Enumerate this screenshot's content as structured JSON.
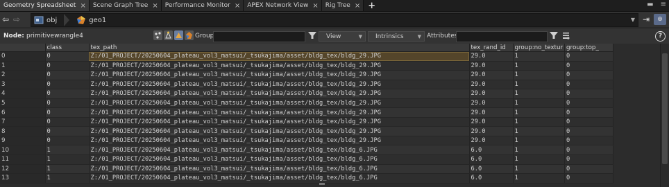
{
  "tabs": [
    {
      "label": "Geometry Spreadsheet",
      "active": true
    },
    {
      "label": "Scene Graph Tree",
      "active": false
    },
    {
      "label": "Performance Monitor",
      "active": false
    },
    {
      "label": "APEX Network View",
      "active": false
    },
    {
      "label": "Rig Tree",
      "active": false
    }
  ],
  "tab_close_glyph": "×",
  "tab_add_glyph": "+",
  "path": {
    "crumbs": [
      "obj",
      "geo1"
    ]
  },
  "toolbar": {
    "node_prefix": "Node:",
    "node_name": "primitivewrangle4",
    "group_label": "Group:",
    "view_label": "View",
    "intrinsics_label": "Intrinsics",
    "attributes_label": "Attributes:",
    "help_glyph": "?"
  },
  "table": {
    "columns": [
      "",
      "class",
      "tex_path",
      "tex_rand_id",
      "group:no_textur",
      "group:top_"
    ],
    "highlight_row": 0,
    "rows": [
      [
        "0",
        "0",
        "Z:/01_PROJECT/20250604_plateau_vol3_matsui/_tsukajima/asset/bldg_tex/bldg_29.JPG",
        "29.0",
        "1",
        "0"
      ],
      [
        "1",
        "0",
        "Z:/01_PROJECT/20250604_plateau_vol3_matsui/_tsukajima/asset/bldg_tex/bldg_29.JPG",
        "29.0",
        "1",
        "0"
      ],
      [
        "2",
        "0",
        "Z:/01_PROJECT/20250604_plateau_vol3_matsui/_tsukajima/asset/bldg_tex/bldg_29.JPG",
        "29.0",
        "1",
        "0"
      ],
      [
        "3",
        "0",
        "Z:/01_PROJECT/20250604_plateau_vol3_matsui/_tsukajima/asset/bldg_tex/bldg_29.JPG",
        "29.0",
        "1",
        "0"
      ],
      [
        "4",
        "0",
        "Z:/01_PROJECT/20250604_plateau_vol3_matsui/_tsukajima/asset/bldg_tex/bldg_29.JPG",
        "29.0",
        "1",
        "0"
      ],
      [
        "5",
        "0",
        "Z:/01_PROJECT/20250604_plateau_vol3_matsui/_tsukajima/asset/bldg_tex/bldg_29.JPG",
        "29.0",
        "1",
        "0"
      ],
      [
        "6",
        "0",
        "Z:/01_PROJECT/20250604_plateau_vol3_matsui/_tsukajima/asset/bldg_tex/bldg_29.JPG",
        "29.0",
        "1",
        "0"
      ],
      [
        "7",
        "0",
        "Z:/01_PROJECT/20250604_plateau_vol3_matsui/_tsukajima/asset/bldg_tex/bldg_29.JPG",
        "29.0",
        "1",
        "0"
      ],
      [
        "8",
        "0",
        "Z:/01_PROJECT/20250604_plateau_vol3_matsui/_tsukajima/asset/bldg_tex/bldg_29.JPG",
        "29.0",
        "1",
        "0"
      ],
      [
        "9",
        "0",
        "Z:/01_PROJECT/20250604_plateau_vol3_matsui/_tsukajima/asset/bldg_tex/bldg_29.JPG",
        "29.0",
        "1",
        "0"
      ],
      [
        "10",
        "1",
        "Z:/01_PROJECT/20250604_plateau_vol3_matsui/_tsukajima/asset/bldg_tex/bldg_6.JPG",
        "6.0",
        "1",
        "0"
      ],
      [
        "11",
        "1",
        "Z:/01_PROJECT/20250604_plateau_vol3_matsui/_tsukajima/asset/bldg_tex/bldg_6.JPG",
        "6.0",
        "1",
        "0"
      ],
      [
        "12",
        "1",
        "Z:/01_PROJECT/20250604_plateau_vol3_matsui/_tsukajima/asset/bldg_tex/bldg_6.JPG",
        "6.0",
        "1",
        "0"
      ],
      [
        "13",
        "1",
        "Z:/01_PROJECT/20250604_plateau_vol3_matsui/_tsukajima/asset/bldg_tex/bldg_6.JPG",
        "6.0",
        "1",
        "0"
      ]
    ]
  },
  "colors": {
    "background": "#2b2b2b",
    "highlight_cell": "#54452a",
    "selected_mode": "#6a7ea0"
  }
}
